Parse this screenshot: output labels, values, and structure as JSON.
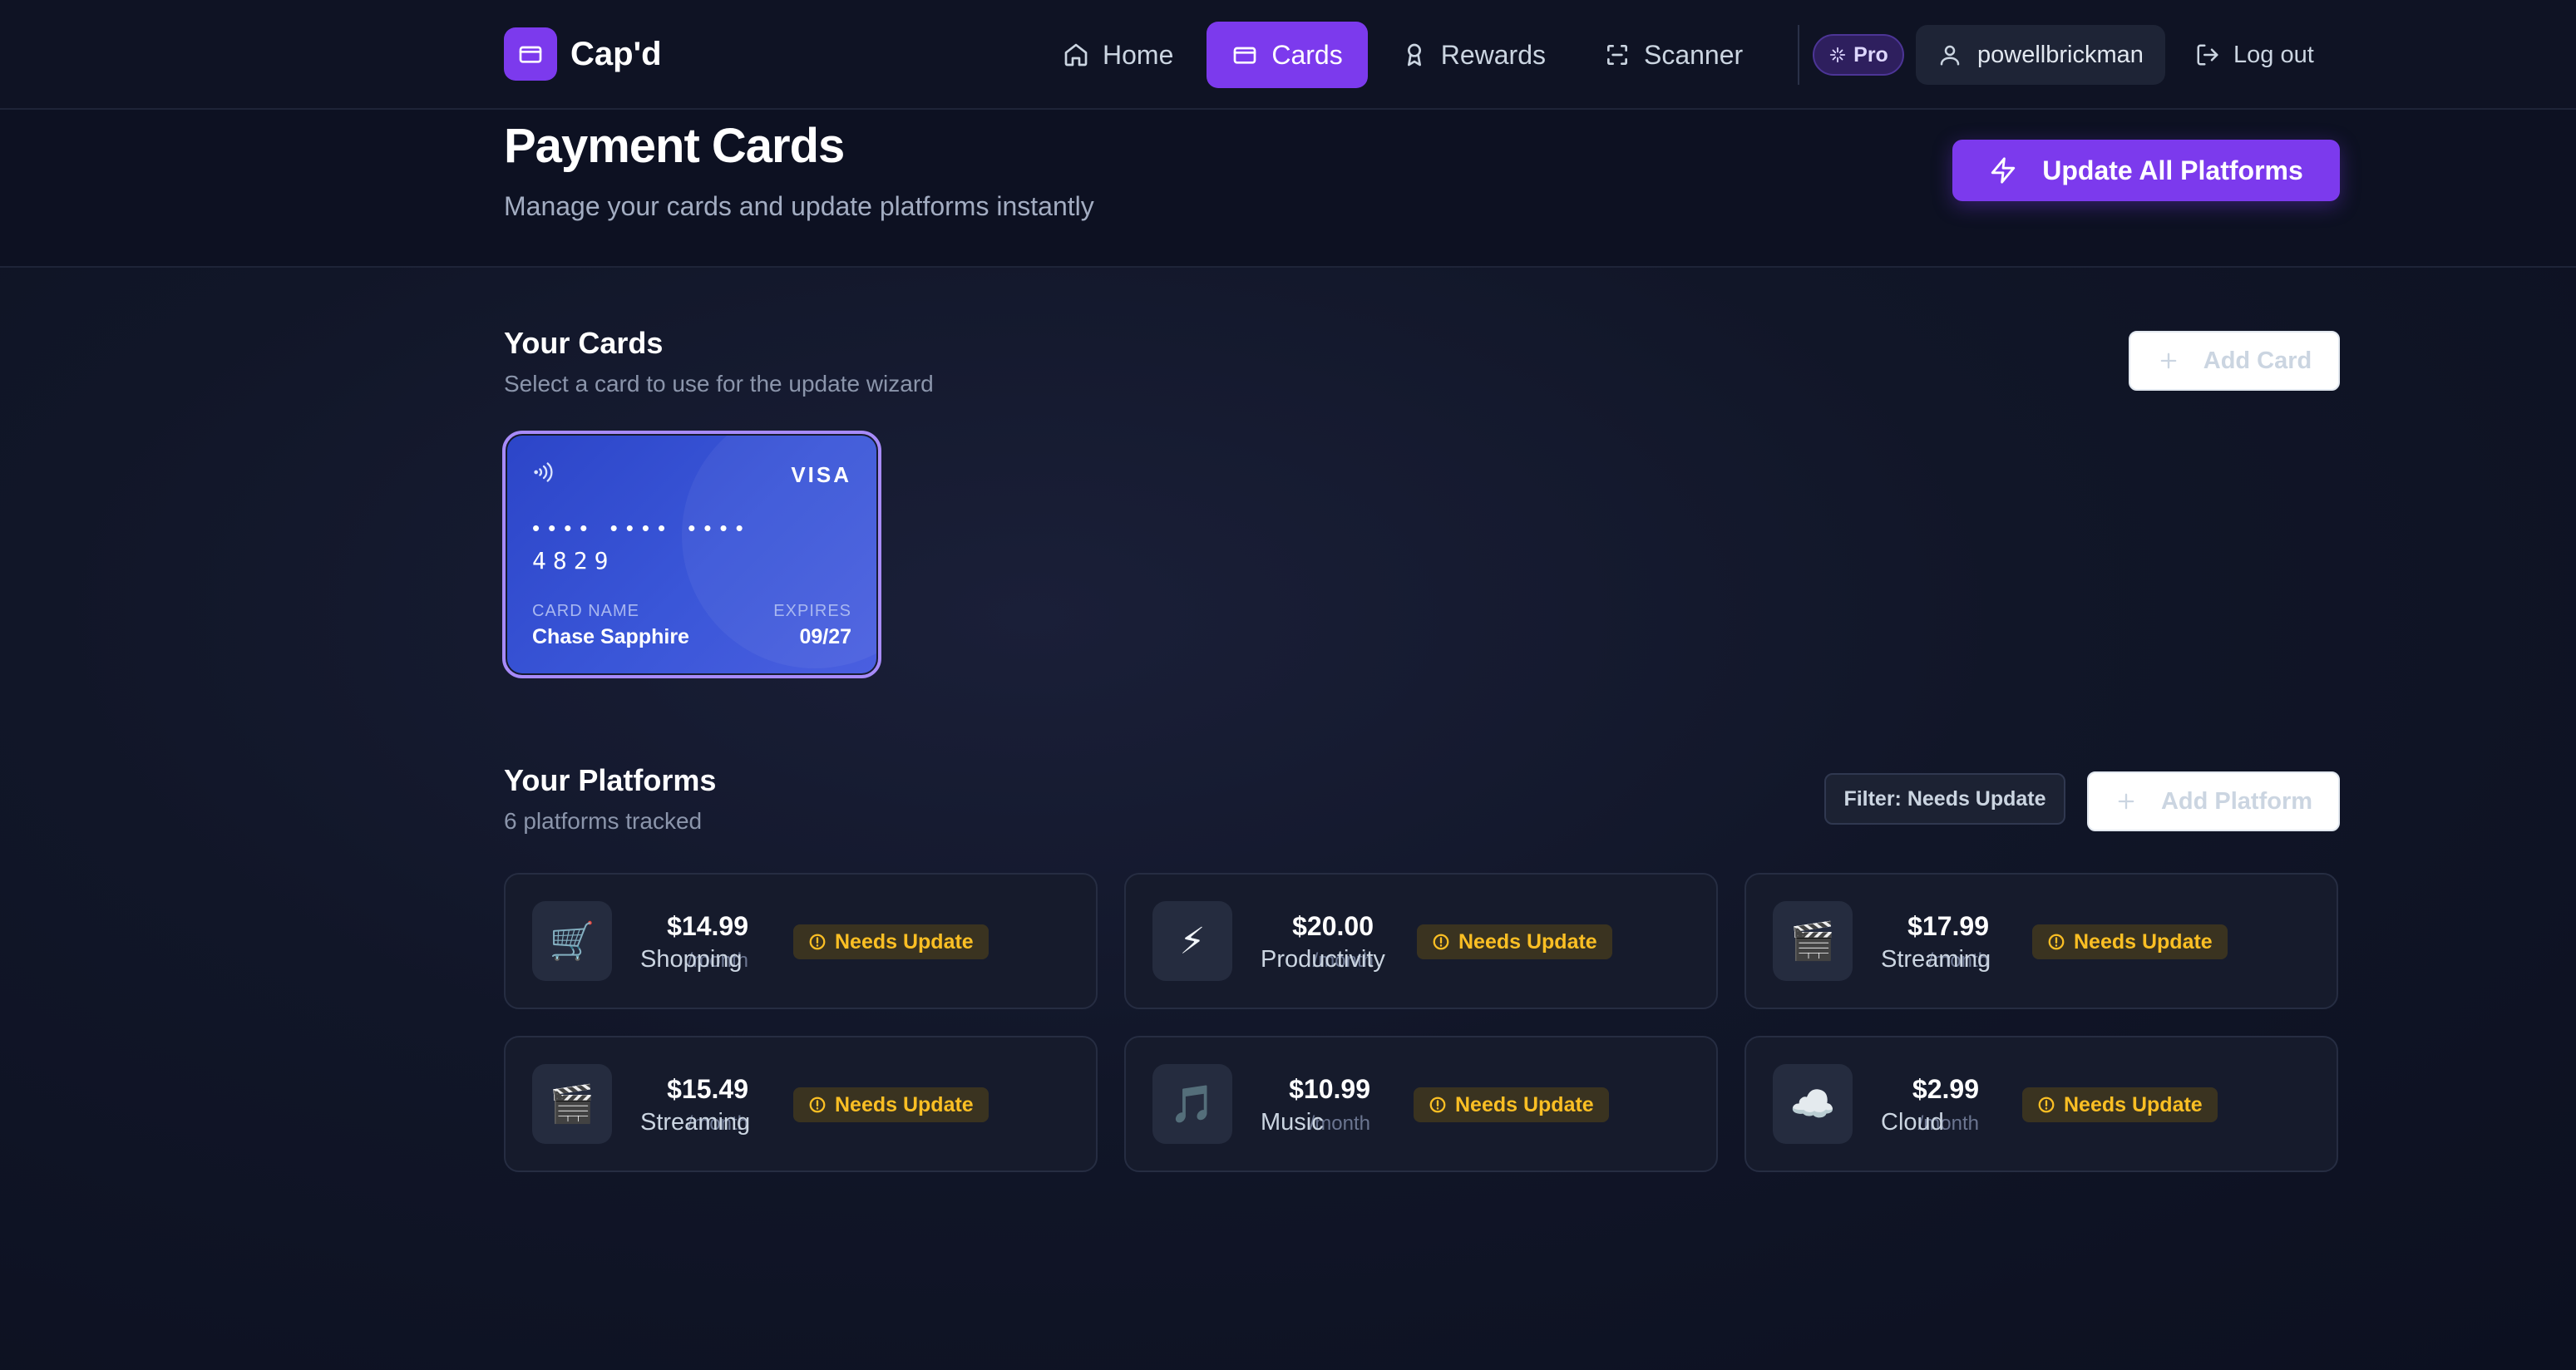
{
  "nav": {
    "brand": "Cap'd",
    "links": [
      {
        "label": "Home",
        "icon": "home-icon"
      },
      {
        "label": "Cards",
        "icon": "card-icon",
        "active": true
      },
      {
        "label": "Rewards",
        "icon": "award-icon"
      },
      {
        "label": "Scanner",
        "icon": "scan-icon"
      }
    ],
    "pro_badge": "Pro",
    "username": "powellbrickman",
    "logout": "Log out"
  },
  "header": {
    "title": "Payment Cards",
    "subtitle": "Manage your cards and update platforms instantly",
    "update_all_label": "Update All Platforms"
  },
  "cards_section": {
    "title": "Your Cards",
    "subtitle": "Select a card to use for the update wizard",
    "add_label": "Add Card",
    "cards": [
      {
        "brand": "VISA",
        "masked": "•••• •••• ••••",
        "last4": "4829",
        "name_label": "CARD NAME",
        "name": "Chase Sapphire",
        "expires_label": "EXPIRES",
        "expires": "09/27"
      }
    ]
  },
  "platforms_section": {
    "title": "Your Platforms",
    "subtitle": "6 platforms tracked",
    "filter_label": "Filter: Needs Update",
    "add_label": "Add Platform",
    "platforms": [
      {
        "icon": "🛒",
        "price": "$14.99",
        "period": "/month",
        "category": "Shopping",
        "status": "Needs Update"
      },
      {
        "icon": "⚡",
        "price": "$20.00",
        "period": "/month",
        "category": "Productivity",
        "status": "Needs Update"
      },
      {
        "icon": "🎬",
        "price": "$17.99",
        "period": "/month",
        "category": "Streaming",
        "status": "Needs Update"
      },
      {
        "icon": "🎬",
        "price": "$15.49",
        "period": "/month",
        "category": "Streaming",
        "status": "Needs Update"
      },
      {
        "icon": "🎵",
        "price": "$10.99",
        "period": "/month",
        "category": "Music",
        "status": "Needs Update"
      },
      {
        "icon": "☁️",
        "price": "$2.99",
        "period": "/month",
        "category": "Cloud",
        "status": "Needs Update"
      }
    ]
  },
  "colors": {
    "accent": "#7c3aed",
    "card_gradient_start": "#2c45c8",
    "warning": "#fbbf24",
    "background": "#111628"
  }
}
